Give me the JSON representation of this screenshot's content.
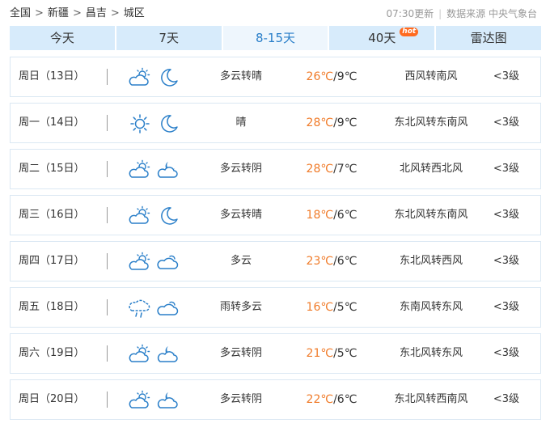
{
  "breadcrumb": {
    "items": [
      "全国",
      "新疆",
      "昌吉",
      "城区"
    ],
    "separator": ">"
  },
  "meta": {
    "update": "07:30更新",
    "source": "数据来源 中央气象台"
  },
  "tabs": [
    {
      "label": "今天"
    },
    {
      "label": "7天"
    },
    {
      "label": "8-15天",
      "active": true
    },
    {
      "label": "40天",
      "badge": "hot"
    },
    {
      "label": "雷达图"
    }
  ],
  "forecast": [
    {
      "date": "周日（13日）",
      "day_icon": "partly-cloudy-day-icon",
      "night_icon": "moon-icon",
      "condition": "多云转晴",
      "high": "26℃",
      "low": "/9℃",
      "wind": "西风转南风",
      "level": "<3级"
    },
    {
      "date": "周一（14日）",
      "day_icon": "sun-icon",
      "night_icon": "moon-icon",
      "condition": "晴",
      "high": "28℃",
      "low": "/9℃",
      "wind": "东北风转东南风",
      "level": "<3级"
    },
    {
      "date": "周二（15日）",
      "day_icon": "partly-cloudy-day-icon",
      "night_icon": "partly-cloudy-night-icon",
      "condition": "多云转阴",
      "high": "28℃",
      "low": "/7℃",
      "wind": "北风转西北风",
      "level": "<3级"
    },
    {
      "date": "周三（16日）",
      "day_icon": "partly-cloudy-day-icon",
      "night_icon": "moon-icon",
      "condition": "多云转晴",
      "high": "18℃",
      "low": "/6℃",
      "wind": "东北风转东南风",
      "level": "<3级"
    },
    {
      "date": "周四（17日）",
      "day_icon": "partly-cloudy-day-icon",
      "night_icon": "cloud-icon",
      "condition": "多云",
      "high": "23℃",
      "low": "/6℃",
      "wind": "东北风转西风",
      "level": "<3级"
    },
    {
      "date": "周五（18日）",
      "day_icon": "rain-icon",
      "night_icon": "cloud-icon",
      "condition": "雨转多云",
      "high": "16℃",
      "low": "/5℃",
      "wind": "东南风转东风",
      "level": "<3级"
    },
    {
      "date": "周六（19日）",
      "day_icon": "partly-cloudy-day-icon",
      "night_icon": "partly-cloudy-night-icon",
      "condition": "多云转阴",
      "high": "21℃",
      "low": "/5℃",
      "wind": "东北风转东风",
      "level": "<3级"
    },
    {
      "date": "周日（20日）",
      "day_icon": "partly-cloudy-day-icon",
      "night_icon": "partly-cloudy-night-icon",
      "condition": "多云转阴",
      "high": "22℃",
      "low": "/6℃",
      "wind": "东北风转西南风",
      "level": "<3级"
    }
  ],
  "colors": {
    "tab_bg": "#d7ebfb",
    "tab_active_bg": "#eef6fd",
    "accent": "#2a7fc9",
    "temp_high": "#f07b29",
    "icon": "#2a7fc9",
    "hot_badge": "#ff6a1f"
  }
}
